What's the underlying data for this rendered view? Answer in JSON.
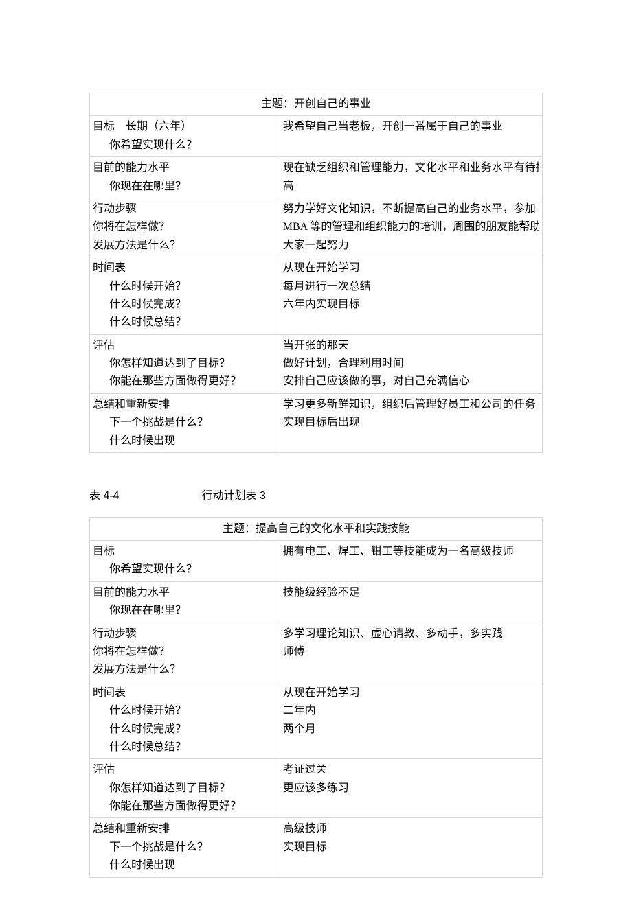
{
  "table1": {
    "title": "主题：开创自己的事业",
    "rows": [
      {
        "left": [
          "目标　长期（六年）",
          "你希望实现什么？"
        ],
        "leftIndent": [
          false,
          true
        ],
        "right": [
          "我希望自己当老板，开创一番属于自己的事业"
        ]
      },
      {
        "left": [
          "目前的能力水平",
          "你现在在哪里？"
        ],
        "leftIndent": [
          false,
          true
        ],
        "right": [
          "现在缺乏组织和管理能力，文化水平和业务水平有待提",
          "高"
        ]
      },
      {
        "left": [
          "行动步骤",
          "你将在怎样做？",
          "发展方法是什么？"
        ],
        "leftIndent": [
          false,
          false,
          false
        ],
        "right": [
          "努力学好文化知识，不断提高自己的业务水平，参加",
          "MBA 等的管理和组织能力的培训，周围的朋友能帮助我",
          "大家一起努力"
        ]
      },
      {
        "left": [
          "时间表",
          "什么时候开始？",
          "什么时候完成？",
          "什么时候总结？"
        ],
        "leftIndent": [
          false,
          true,
          true,
          true
        ],
        "right": [
          "从现在开始学习",
          "每月进行一次总结",
          "六年内实现目标"
        ]
      },
      {
        "left": [
          "评估",
          "你怎样知道达到了目标？",
          "你能在那些方面做得更好？"
        ],
        "leftIndent": [
          false,
          true,
          true
        ],
        "right": [
          "当开张的那天",
          "做好计划，合理利用时间",
          "安排自己应该做的事，对自己充满信心"
        ]
      },
      {
        "left": [
          "总结和重新安排",
          "下一个挑战是什么？",
          "什么时候出现"
        ],
        "leftIndent": [
          false,
          true,
          true
        ],
        "right": [
          "学习更多新鲜知识，组织后管理好员工和公司的任务",
          "实现目标后出现"
        ]
      }
    ]
  },
  "caption2": {
    "num": "表 4-4",
    "title": "行动计划表 3"
  },
  "table2": {
    "title": "主题：提高自己的文化水平和实践技能",
    "rows": [
      {
        "left": [
          "目标",
          "你希望实现什么？"
        ],
        "leftIndent": [
          false,
          true
        ],
        "right": [
          "拥有电工、焊工、钳工等技能成为一名高级技师"
        ]
      },
      {
        "left": [
          "目前的能力水平",
          "你现在在哪里？"
        ],
        "leftIndent": [
          false,
          true
        ],
        "right": [
          "技能级经验不足"
        ]
      },
      {
        "left": [
          "行动步骤",
          "你将在怎样做？",
          "发展方法是什么？"
        ],
        "leftIndent": [
          false,
          false,
          false
        ],
        "right": [
          "多学习理论知识、虚心请教、多动手，多实践",
          "师傅"
        ]
      },
      {
        "left": [
          "时间表",
          "什么时候开始？",
          "什么时候完成？",
          "什么时候总结？"
        ],
        "leftIndent": [
          false,
          true,
          true,
          true
        ],
        "right": [
          "从现在开始学习",
          "二年内",
          "两个月"
        ]
      },
      {
        "left": [
          "评估",
          "你怎样知道达到了目标？",
          "你能在那些方面做得更好？"
        ],
        "leftIndent": [
          false,
          true,
          true
        ],
        "right": [
          "考证过关",
          "更应该多练习"
        ]
      },
      {
        "left": [
          "总结和重新安排",
          "下一个挑战是什么？",
          "什么时候出现"
        ],
        "leftIndent": [
          false,
          true,
          true
        ],
        "right": [
          "高级技师",
          "实现目标"
        ]
      }
    ]
  }
}
